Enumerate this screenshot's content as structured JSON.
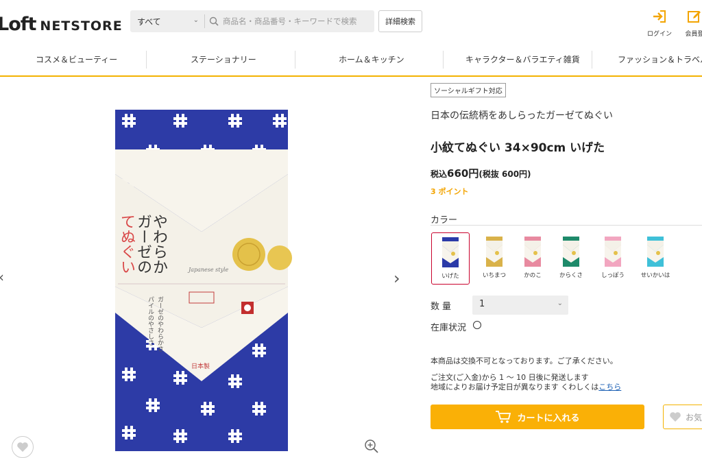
{
  "header": {
    "logo_mark": "Loft",
    "logo_text": "NETSTORE",
    "search": {
      "category_value": "すべて",
      "placeholder": "商品名・商品番号・キーワードで検索"
    },
    "advanced_search_label": "詳細検索",
    "login_label": "ログイン",
    "register_label": "会員登"
  },
  "categories": [
    "コスメ＆ビューティー",
    "ステーショナリー",
    "ホーム＆キッチン",
    "キャラクター＆バラエティ雑貨",
    "ファッション＆トラベル&"
  ],
  "product": {
    "badge": "ソーシャルギフト対応",
    "catch_copy": "日本の伝統柄をあしらったガーゼてぬぐい",
    "title": "小紋てぬぐい 34×90cm いげた",
    "price_prefix": "税込",
    "price_value": "660円",
    "price_suffix": "(税抜 600円)",
    "points": "3 ポイント",
    "color_label": "カラー",
    "colors": [
      {
        "name": "いげた",
        "color": "#2b3aa8",
        "selected": true
      },
      {
        "name": "いちまつ",
        "color": "#d9b24a",
        "selected": false
      },
      {
        "name": "かのこ",
        "color": "#e88aa0",
        "selected": false
      },
      {
        "name": "からくさ",
        "color": "#1e8a6a",
        "selected": false
      },
      {
        "name": "しっぽう",
        "color": "#f2a6c0",
        "selected": false
      },
      {
        "name": "せいかいは",
        "color": "#3fc0d8",
        "selected": false
      }
    ],
    "quantity_label": "数量",
    "quantity_value": "1",
    "stock_label": "在庫状況",
    "note_exchange": "本商品は交換不可となっております。ご了承ください。",
    "note_shipping1": "ご注文(ご入金)から 1 ～ 10 日後に発送します",
    "note_shipping2": "地域によりお届け予定日が異なります くわしくは",
    "note_link": "こちら",
    "cart_label": "カートに入れる",
    "fav_label": "お気"
  },
  "package": {
    "vertical_title_1": "やわらか",
    "vertical_title_2": "ガーゼの",
    "vertical_title_3": "てぬぐい",
    "brand": "Japanese style",
    "made_in": "日本製",
    "gauze_line_1": "ガーゼのやわらかさ",
    "gauze_line_2": "パイルのやさしさ"
  },
  "colors": {
    "accent": "#fab006",
    "nav_border": "#f3b200",
    "indigo": "#2b3aa8"
  }
}
